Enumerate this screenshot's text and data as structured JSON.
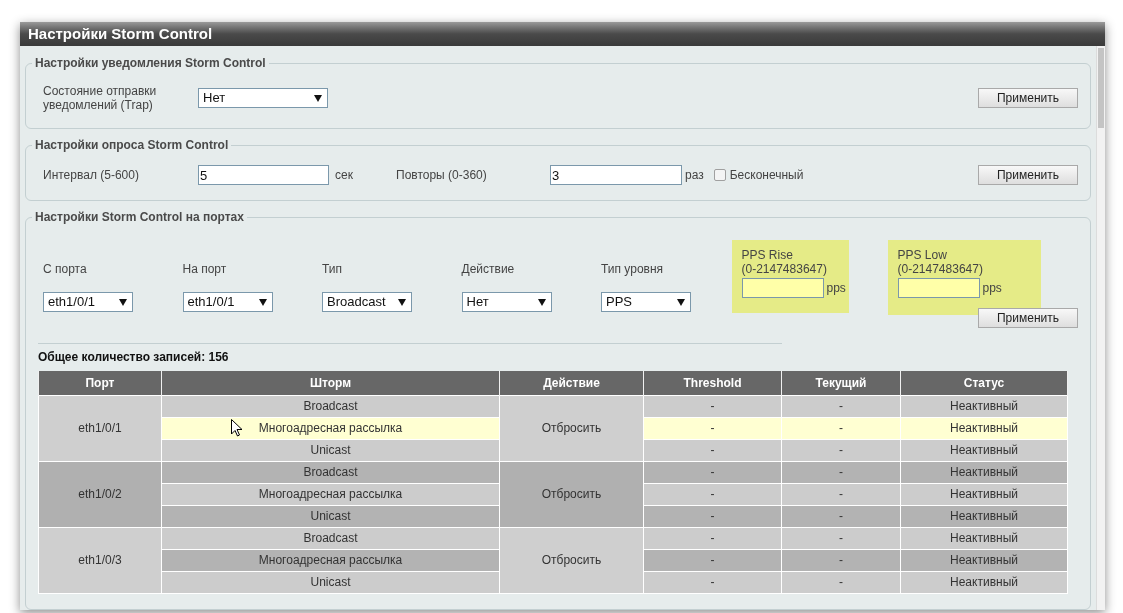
{
  "window": {
    "title": "Настройки Storm Control"
  },
  "notification_settings": {
    "legend": "Настройки уведомления Storm Control",
    "label": "Состояние отправки уведомлений (Trap)",
    "value": "Нет",
    "apply": "Применить"
  },
  "polling_settings": {
    "legend": "Настройки опроса Storm Control",
    "interval_label": "Интервал (5-600)",
    "interval_value": "5",
    "interval_unit": "сек",
    "retries_label": "Повторы (0-360)",
    "retries_value": "3",
    "retries_unit": "раз",
    "infinite": {
      "label": "Бесконечный",
      "checked": false
    },
    "apply": "Применить"
  },
  "port_settings": {
    "legend": "Настройки Storm Control на портах",
    "selects": [
      {
        "label": "С порта",
        "value": "eth1/0/1"
      },
      {
        "label": "На порт",
        "value": "eth1/0/1"
      },
      {
        "label": "Тип",
        "value": "Broadcast"
      },
      {
        "label": "Действие",
        "value": "Нет"
      },
      {
        "label": "Тип уровня",
        "value": "PPS"
      }
    ],
    "pps_fields": [
      {
        "label": "PPS Rise",
        "range": "(0-2147483647)",
        "unit": "pps",
        "highlighted": true
      },
      {
        "label": "PPS Low",
        "range": "(0-2147483647)",
        "unit": "pps",
        "highlighted": true
      }
    ],
    "apply": "Применить"
  },
  "total": "Общее количество записей: 156",
  "table": {
    "columns": [
      "Порт",
      "Шторм",
      "Действие",
      "Threshold",
      "Текущий",
      "Статус"
    ],
    "rows": [
      {
        "port": "eth1/0/1",
        "action": "Отбросить",
        "storms": [
          {
            "type": "Broadcast",
            "threshold": "-",
            "current": "-",
            "status": "Неактивный",
            "highlighted": false
          },
          {
            "type": "Многоадресная рассылка",
            "threshold": "-",
            "current": "-",
            "status": "Неактивный",
            "highlighted": true
          },
          {
            "type": "Unicast",
            "threshold": "-",
            "current": "-",
            "status": "Неактивный",
            "highlighted": false
          }
        ]
      },
      {
        "port": "eth1/0/2",
        "action": "Отбросить",
        "storms": [
          {
            "type": "Broadcast",
            "threshold": "-",
            "current": "-",
            "status": "Неактивный",
            "highlighted": false
          },
          {
            "type": "Многоадресная рассылка",
            "threshold": "-",
            "current": "-",
            "status": "Неактивный",
            "highlighted": false
          },
          {
            "type": "Unicast",
            "threshold": "-",
            "current": "-",
            "status": "Неактивный",
            "highlighted": false
          }
        ]
      },
      {
        "port": "eth1/0/3",
        "action": "Отбросить",
        "storms": [
          {
            "type": "Broadcast",
            "threshold": "-",
            "current": "-",
            "status": "Неактивный",
            "highlighted": false
          },
          {
            "type": "Многоадресная рассылка",
            "threshold": "-",
            "current": "-",
            "status": "Неактивный",
            "highlighted": false
          },
          {
            "type": "Unicast",
            "threshold": "-",
            "current": "-",
            "status": "Неактивный",
            "highlighted": false
          }
        ]
      }
    ]
  }
}
